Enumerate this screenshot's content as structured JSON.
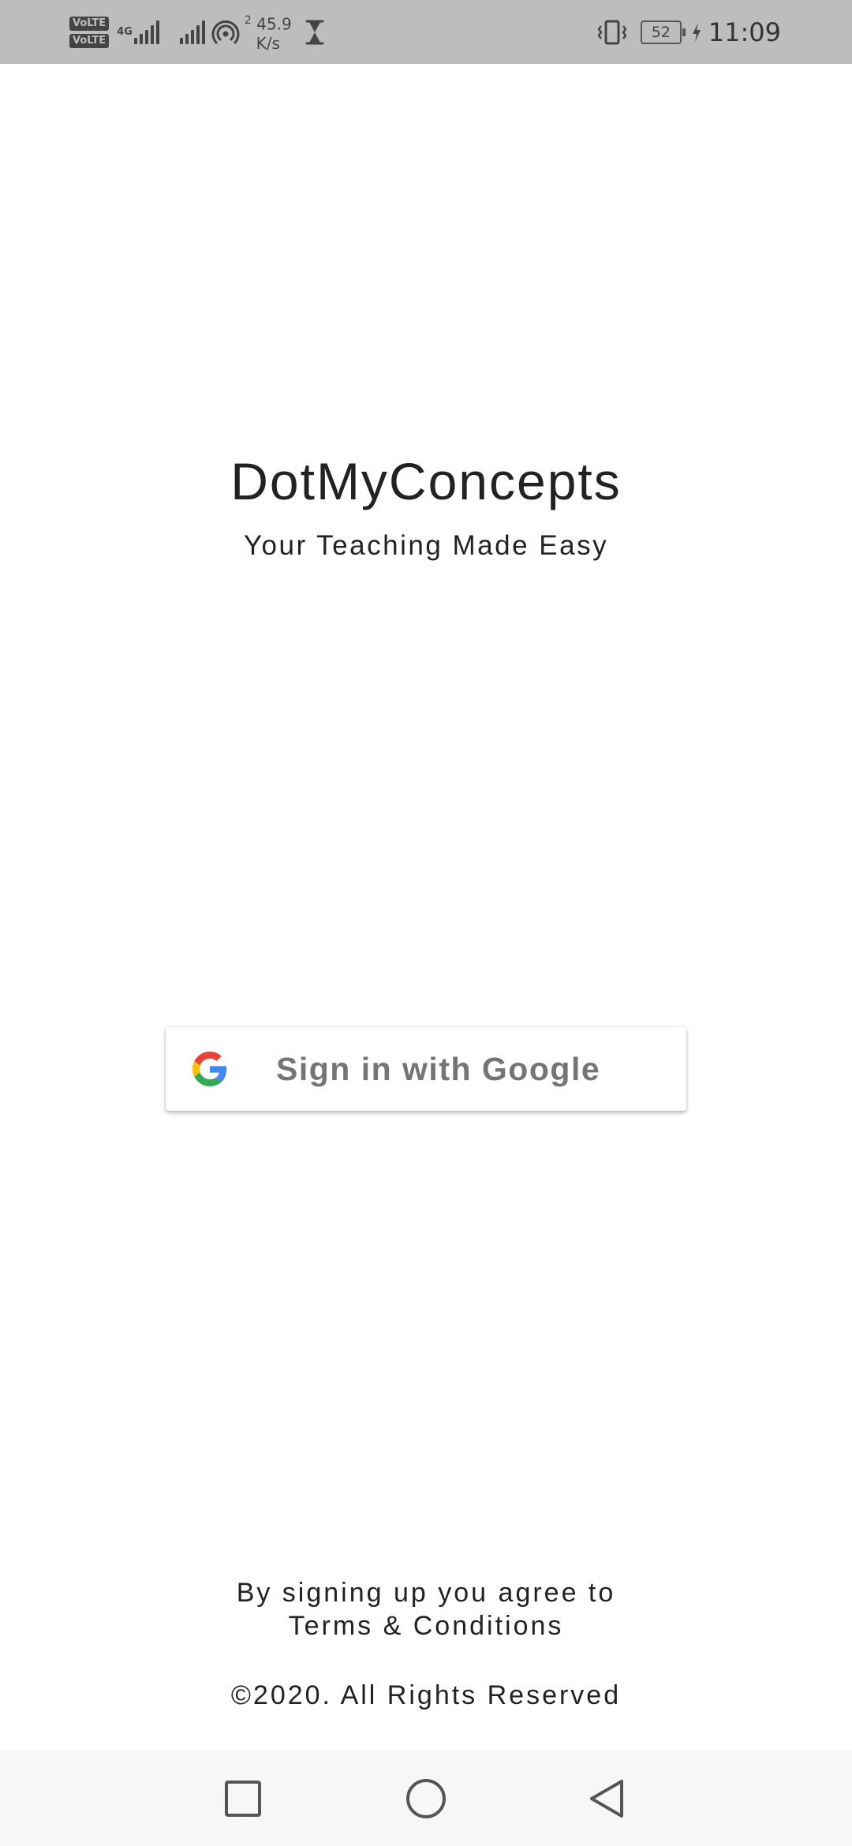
{
  "status_bar": {
    "volte_1": "VoLTE",
    "volte_2": "VoLTE",
    "network_type": "4G",
    "hotspot_clients": "2",
    "net_speed_value": "45.9",
    "net_speed_unit": "K/s",
    "battery_level": "52",
    "time": "11:09",
    "icons": [
      "volte-icon",
      "signal-icon",
      "hotspot-icon",
      "hourglass-icon",
      "vibrate-icon",
      "battery-icon",
      "charging-icon"
    ]
  },
  "header": {
    "title": "DotMyConcepts",
    "subtitle": "Your Teaching Made Easy"
  },
  "signin": {
    "label": "Sign in with Google",
    "icon": "google-icon"
  },
  "footer": {
    "terms_line1": "By signing up you agree to",
    "terms_link": "Terms & Conditions",
    "copyright": "©2020. All Rights Reserved"
  },
  "nav_bar": {
    "icons": [
      "recents-icon",
      "home-icon",
      "back-icon"
    ]
  },
  "colors": {
    "status_bar_bg": "#bdbdbd",
    "background": "#ffffff",
    "text": "#222222",
    "button_text": "#757575",
    "nav_bar_bg": "#f7f7f7"
  }
}
